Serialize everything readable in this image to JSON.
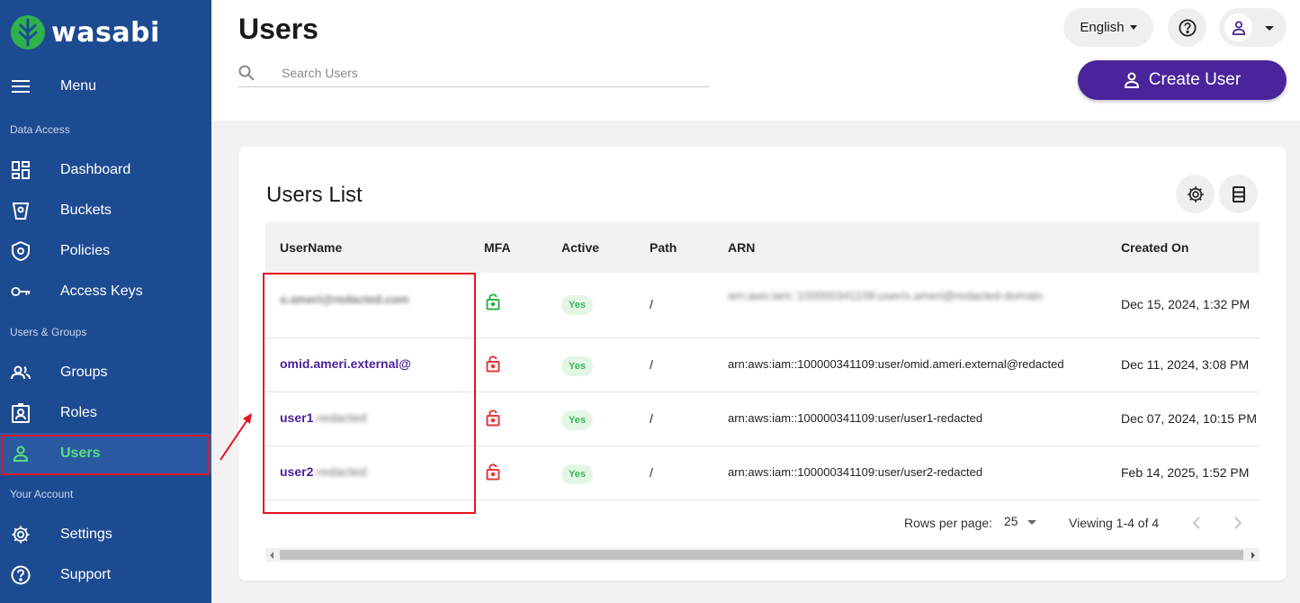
{
  "brand": {
    "name": "wasabi",
    "color": "#2fb24c"
  },
  "sidebar": {
    "menu_label": "Menu",
    "sections": [
      "Data Access",
      "Users & Groups",
      "Your Account"
    ],
    "items": [
      {
        "label": "Dashboard",
        "icon": "dashboard-icon"
      },
      {
        "label": "Buckets",
        "icon": "bucket-icon"
      },
      {
        "label": "Policies",
        "icon": "shield-icon"
      },
      {
        "label": "Access Keys",
        "icon": "key-icon"
      },
      {
        "label": "Groups",
        "icon": "groups-icon"
      },
      {
        "label": "Roles",
        "icon": "badge-icon"
      },
      {
        "label": "Users",
        "icon": "user-icon",
        "active": true
      },
      {
        "label": "Settings",
        "icon": "gear-icon"
      },
      {
        "label": "Support",
        "icon": "help-icon"
      }
    ]
  },
  "header": {
    "title": "Users",
    "search_placeholder": "Search Users",
    "language": "English",
    "create_label": "Create User"
  },
  "card": {
    "title": "Users List",
    "columns": [
      "UserName",
      "MFA",
      "Active",
      "Path",
      "ARN",
      "Created On"
    ],
    "rows": [
      {
        "username": "o.ameri@redacted.com",
        "username_redacted": true,
        "mfa": "enabled",
        "active": "Yes",
        "path": "/",
        "arn": "arn:aws:iam::100000341109:user/o.ameri@redacted-domain",
        "created": "Dec 15, 2024, 1:32 PM"
      },
      {
        "username": "omid.ameri.external@",
        "mfa": "disabled",
        "active": "Yes",
        "path": "/",
        "arn": "arn:aws:iam::100000341109:user/omid.ameri.external@redacted",
        "created": "Dec 11, 2024, 3:08 PM"
      },
      {
        "username": "user1",
        "username_suffix": "-redacted",
        "mfa": "disabled",
        "active": "Yes",
        "path": "/",
        "arn": "arn:aws:iam::100000341109:user/user1-redacted",
        "created": "Dec 07, 2024, 10:15 PM"
      },
      {
        "username": "user2",
        "username_suffix": "-redacted",
        "mfa": "disabled",
        "active": "Yes",
        "path": "/",
        "arn": "arn:aws:iam::100000341109:user/user2-redacted",
        "created": "Feb 14, 2025, 1:52 PM"
      }
    ],
    "footer": {
      "rows_per_page_label": "Rows per page:",
      "rows_per_page_value": "25",
      "viewing": "Viewing 1-4 of 4"
    }
  },
  "colors": {
    "sidebar": "#1d4b91",
    "accent": "#4a249a",
    "active_nav": "#58e07a",
    "mfa_on": "#2fb24c",
    "mfa_off": "#e0383e",
    "highlight": "#e8141c"
  }
}
